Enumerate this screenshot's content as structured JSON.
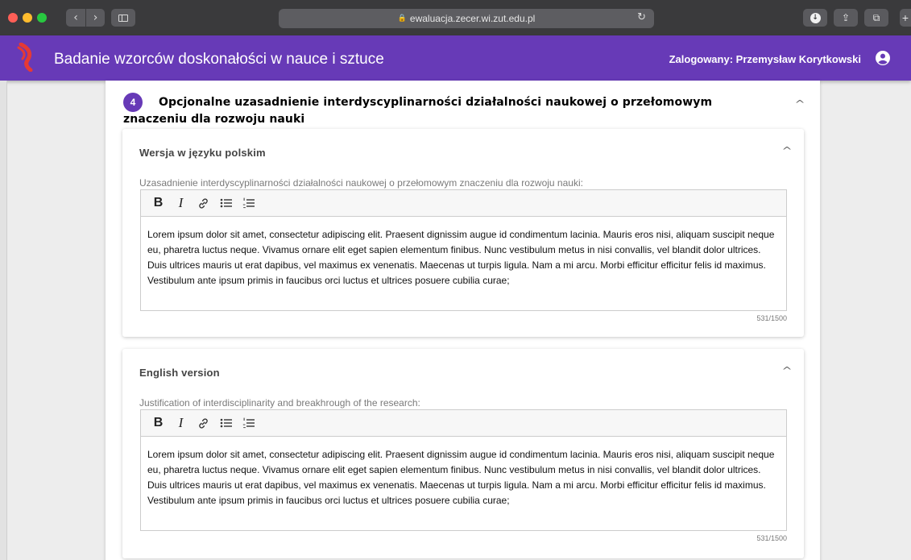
{
  "browser": {
    "url": "ewaluacja.zecer.wi.zut.edu.pl",
    "back_glyph": "‹",
    "forward_glyph": "›",
    "lock_glyph": "🔒",
    "reload_glyph": "↻",
    "share_glyph": "⇪",
    "tabs_glyph": "⧉",
    "new_tab_glyph": "+",
    "download_glyph": "↓",
    "icons": [
      "back-icon",
      "forward-icon",
      "sidebar-icon",
      "lock-icon",
      "reload-icon",
      "download-icon",
      "share-icon",
      "tabs-icon",
      "new-tab-icon"
    ]
  },
  "appbar": {
    "title": "Badanie wzorców doskonałości w nauce i sztuce",
    "user": "Zalogowany: Przemysław Korytkowski",
    "background_color": "#673ab7",
    "logo_color": "#e53935"
  },
  "section": {
    "number": "4",
    "title": "Opcjonalne uzasadnienie interdyscyplinarności działalności naukowej o przełomowym znaczeniu dla rozwoju nauki",
    "chevron_glyph": "^"
  },
  "panels": [
    {
      "title": "Wersja w języku polskim",
      "field_label": "Uzasadnienie interdyscyplinarności działalności naukowej o przełomowym znaczeniu dla rozwoju nauki:",
      "toolbar": {
        "bold": "B",
        "italic": "I"
      },
      "text": "Lorem ipsum dolor sit amet, consectetur adipiscing elit. Praesent dignissim augue id condimentum lacinia. Mauris eros nisi, aliquam suscipit neque eu, pharetra luctus neque. Vivamus ornare elit eget sapien elementum finibus. Nunc vestibulum metus in nisi convallis, vel blandit dolor ultrices. Duis ultrices mauris ut erat dapibus, vel maximus ex venenatis. Maecenas ut turpis ligula. Nam a mi arcu. Morbi efficitur efficitur felis id maximus. Vestibulum ante ipsum primis in faucibus orci luctus et ultrices posuere cubilia curae;",
      "counter": "531/1500"
    },
    {
      "title": "English version",
      "field_label": "Justification of interdisciplinarity and breakhrough of the research:",
      "toolbar": {
        "bold": "B",
        "italic": "I"
      },
      "text": "Lorem ipsum dolor sit amet, consectetur adipiscing elit. Praesent dignissim augue id condimentum lacinia. Mauris eros nisi, aliquam suscipit neque eu, pharetra luctus neque. Vivamus ornare elit eget sapien elementum finibus. Nunc vestibulum metus in nisi convallis, vel blandit dolor ultrices. Duis ultrices mauris ut erat dapibus, vel maximus ex venenatis. Maecenas ut turpis ligula. Nam a mi arcu. Morbi efficitur efficitur felis id maximus. Vestibulum ante ipsum primis in faucibus orci luctus et ultrices posuere cubilia curae;",
      "counter": "531/1500"
    }
  ]
}
